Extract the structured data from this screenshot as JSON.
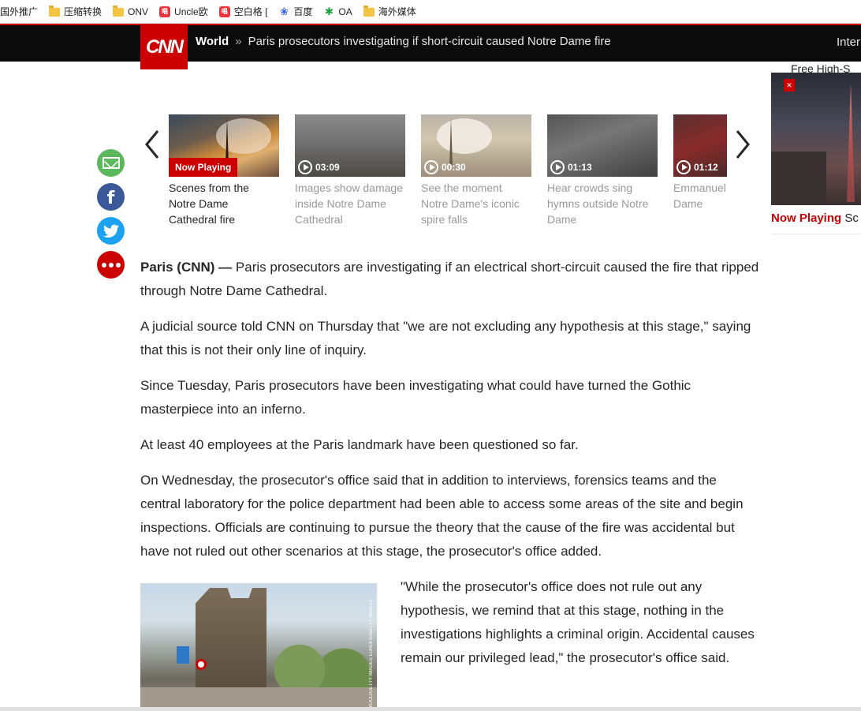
{
  "bookmarks": [
    {
      "label": "国外推广",
      "icon": "none"
    },
    {
      "label": "压缩转换",
      "icon": "folder-icon"
    },
    {
      "label": "ONV",
      "icon": "folder-icon"
    },
    {
      "label": "Uncle欧",
      "icon": "weibo-icon"
    },
    {
      "label": "空白格 [",
      "icon": "weibo-icon"
    },
    {
      "label": "百度",
      "icon": "baidu-paw-icon"
    },
    {
      "label": "OA",
      "icon": "oa-icon"
    },
    {
      "label": "海外媒体",
      "icon": "folder-icon"
    }
  ],
  "header": {
    "logo": "CNN",
    "section": "World",
    "separator": "»",
    "headline": "Paris prosecutors investigating if short-circuit caused Notre Dame fire",
    "right_nav": "Inter"
  },
  "right_rail": {
    "promo_text": "Free High-S",
    "now_playing_label": "Now Playing",
    "now_playing_title": "Sc"
  },
  "carousel": {
    "items": [
      {
        "badge": "Now Playing",
        "duration": "",
        "caption": "Scenes from the Notre Dame Cathedral fire",
        "active": true
      },
      {
        "badge": "",
        "duration": "03:09",
        "caption": "Images show damage inside Notre Dame Cathedral",
        "active": false
      },
      {
        "badge": "",
        "duration": "00:30",
        "caption": "See the moment Notre Dame's iconic spire falls",
        "active": false
      },
      {
        "badge": "",
        "duration": "01:13",
        "caption": "Hear crowds sing hymns outside Notre Dame",
        "active": false
      },
      {
        "badge": "",
        "duration": "01:12",
        "caption": "Emmanuel We will reb Dame",
        "active": false
      }
    ]
  },
  "social": [
    "email-icon",
    "facebook-icon",
    "twitter-icon",
    "more-icon"
  ],
  "article": {
    "dateline": "Paris (CNN) —",
    "paragraphs": [
      "Paris prosecutors are investigating if an electrical short-circuit caused the fire that ripped through Notre Dame Cathedral.",
      "A judicial source told CNN on Thursday that \"we are not excluding any hypothesis at this stage,\" saying that this is not their only line of inquiry.",
      "Since Tuesday, Paris prosecutors have been investigating what could have turned the Gothic masterpiece into an inferno.",
      "At least 40 employees at the Paris landmark have been questioned so far.",
      "On Wednesday, the prosecutor's office said that in addition to interviews, forensics teams and the central laboratory for the police department had been able to access some areas of the site and begin inspections. Officials are continuing to pursue the theory that the cause of the fire was accidental but have not ruled out other scenarios at this stage, the prosecutor's office added."
    ],
    "photo_credit": "WOOD/GETTY IMAGES EUROPE/GETTY IMAGES",
    "quote": "\"While the prosecutor's office does not rule out any hypothesis, we remind that at this stage, nothing in the investigations highlights a criminal origin. Accidental causes remain our privileged lead,\" the prosecutor's office said."
  },
  "colors": {
    "brand_red": "#cc0000",
    "header_bg": "#0c0c0c",
    "text": "#262626",
    "muted": "#999999"
  }
}
